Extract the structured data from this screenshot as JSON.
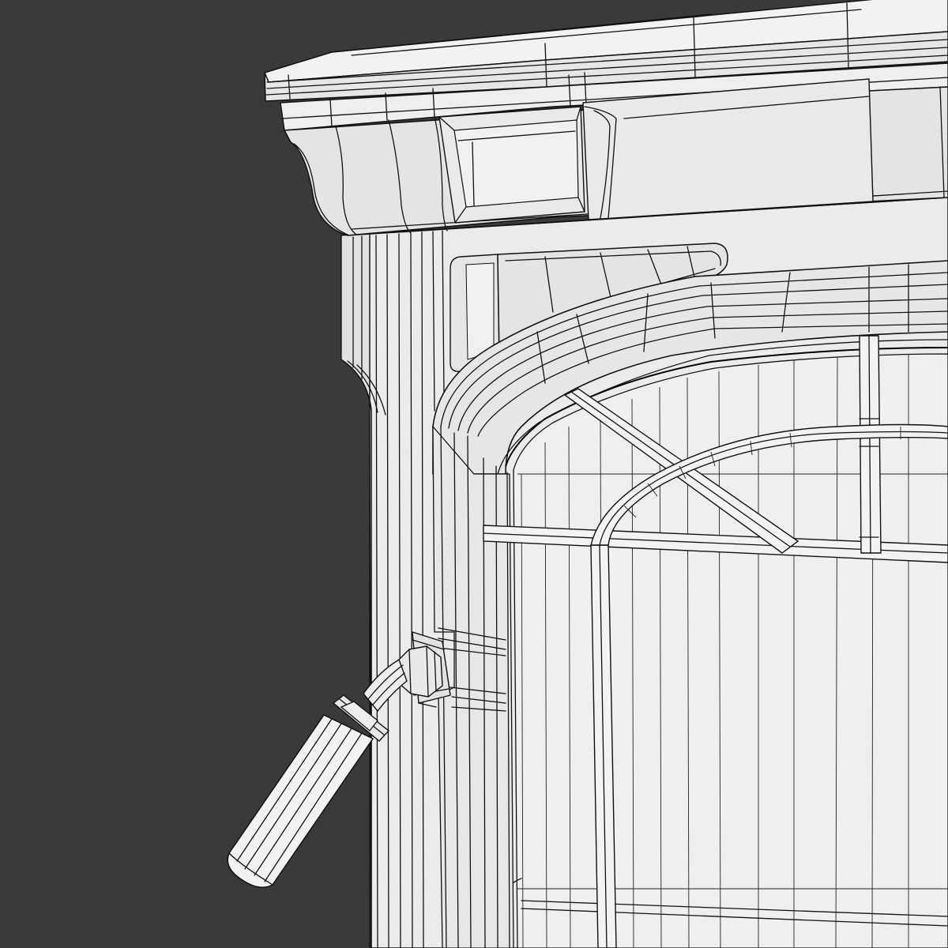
{
  "scene": {
    "subject": "wireframe-render",
    "colors": {
      "background": "#3a3a3a",
      "surface": "#e9e9e9",
      "surface_shadow": "#d6d6d6",
      "surface_light": "#f3f3f3",
      "wire": "#111111"
    }
  }
}
